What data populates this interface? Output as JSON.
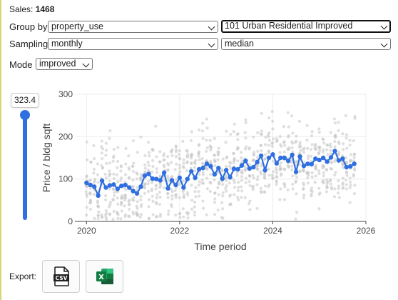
{
  "sales": {
    "label": "Sales:",
    "count": "1468"
  },
  "controls": {
    "group_by": {
      "label": "Group by",
      "field": "property_use",
      "value": "101 Urban Residential Improved"
    },
    "sampling": {
      "label": "Sampling",
      "period": "monthly",
      "statistic": "median"
    },
    "mode": {
      "label": "Mode",
      "value": "improved"
    }
  },
  "slider": {
    "value": "323.4",
    "level_fraction": 1.0
  },
  "export": {
    "label": "Export:",
    "csv_icon": "csv-file-icon",
    "excel_icon": "excel-icon"
  },
  "colors": {
    "accent": "#2f6fe0",
    "scatter": "#c4c4c4",
    "grid": "#ececec"
  },
  "chart_data": {
    "type": "line",
    "xlabel": "Time period",
    "ylabel": "Price / bldg sqft",
    "xlim": [
      2019.75,
      2026.0
    ],
    "ylim": [
      0,
      300
    ],
    "x_ticks": [
      "2020",
      "2022",
      "2024",
      "2026"
    ],
    "x_tick_values": [
      2020,
      2022,
      2024,
      2026
    ],
    "y_ticks": [
      "0",
      "100",
      "200",
      "300"
    ],
    "y_tick_values": [
      0,
      100,
      200,
      300
    ],
    "grid": true,
    "series": [
      {
        "style": "line-markers",
        "x_start": "2020-01",
        "frequency": "monthly",
        "values": [
          91,
          86,
          82,
          61,
          96,
          80,
          85,
          87,
          77,
          84,
          86,
          80,
          72,
          66,
          82,
          108,
          112,
          101,
          100,
          97,
          115,
          78,
          97,
          86,
          103,
          80,
          100,
          118,
          103,
          123,
          126,
          136,
          130,
          111,
          126,
          101,
          121,
          104,
          124,
          123,
          132,
          143,
          125,
          128,
          140,
          155,
          121,
          150,
          158,
          137,
          150,
          150,
          143,
          157,
          117,
          153,
          131,
          136,
          135,
          148,
          145,
          150,
          141,
          151,
          166,
          144,
          148,
          128,
          130,
          136
        ]
      }
    ],
    "scatter": {
      "note": "individual sales",
      "count": "1468"
    }
  }
}
